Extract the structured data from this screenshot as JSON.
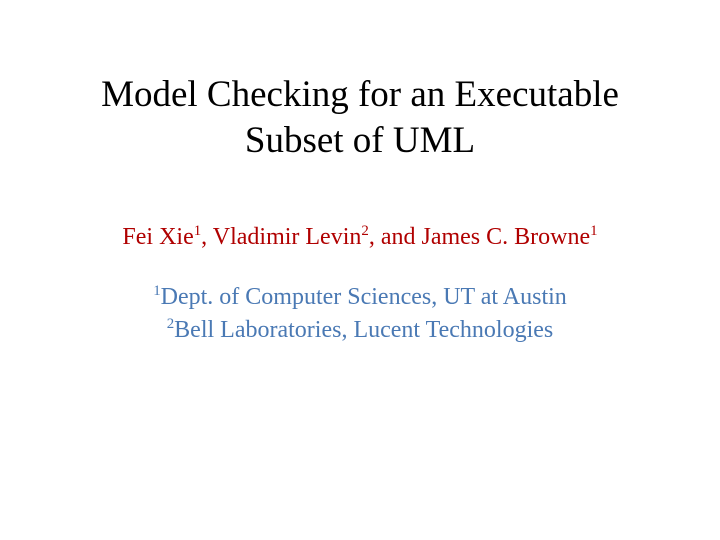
{
  "title_line1": "Model Checking for an Executable",
  "title_line2": "Subset of UML",
  "authors": {
    "a1_name": "Fei Xie",
    "a1_sup": "1",
    "sep1": ", ",
    "a2_name": "Vladimir Levin",
    "a2_sup": "2",
    "sep2": ",  and ",
    "a3_name": "James C. Browne",
    "a3_sup": "1"
  },
  "affils": {
    "l1_sup": "1",
    "l1_text": "Dept. of Computer Sciences, UT at Austin",
    "l2_sup": "2",
    "l2_text": "Bell Laboratories, Lucent Technologies"
  }
}
